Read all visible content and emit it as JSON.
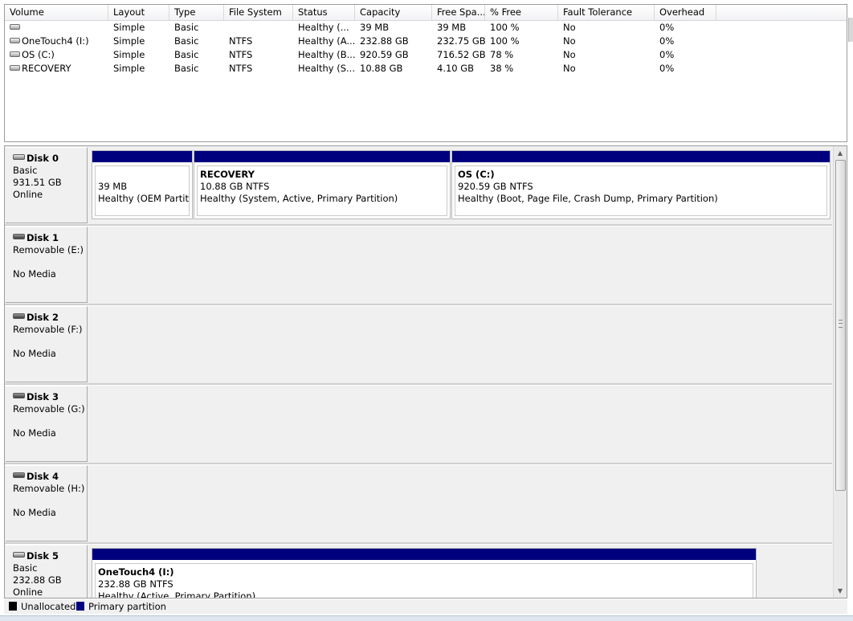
{
  "volume_list": {
    "columns": [
      "Volume",
      "Layout",
      "Type",
      "File System",
      "Status",
      "Capacity",
      "Free Spa...",
      "% Free",
      "Fault Tolerance",
      "Overhead"
    ],
    "rows": [
      [
        "",
        "Simple",
        "Basic",
        "",
        "Healthy (...",
        "39 MB",
        "39 MB",
        "100 %",
        "No",
        "0%"
      ],
      [
        "OneTouch4 (I:)",
        "Simple",
        "Basic",
        "NTFS",
        "Healthy (A...",
        "232.88 GB",
        "232.75 GB",
        "100 %",
        "No",
        "0%"
      ],
      [
        "OS (C:)",
        "Simple",
        "Basic",
        "NTFS",
        "Healthy (B...",
        "920.59 GB",
        "716.52 GB",
        "78 %",
        "No",
        "0%"
      ],
      [
        "RECOVERY",
        "Simple",
        "Basic",
        "NTFS",
        "Healthy (S...",
        "10.88 GB",
        "4.10 GB",
        "38 %",
        "No",
        "0%"
      ]
    ]
  },
  "disks": [
    {
      "title": "Disk 0",
      "line1": "Basic",
      "line2": "931.51 GB",
      "line3": "Online",
      "icon": "hard-disk-icon",
      "partitions": [
        {
          "name": "",
          "size": "39 MB",
          "status": "Healthy (OEM Partition)"
        },
        {
          "name": "RECOVERY",
          "size": "10.88 GB NTFS",
          "status": "Healthy (System, Active, Primary Partition)"
        },
        {
          "name": "OS  (C:)",
          "size": "920.59 GB NTFS",
          "status": "Healthy (Boot, Page File, Crash Dump, Primary Partition)"
        }
      ]
    },
    {
      "title": "Disk 1",
      "line1": "Removable (E:)",
      "line2": "",
      "line3": "No Media",
      "icon": "removable-disk-icon",
      "partitions": []
    },
    {
      "title": "Disk 2",
      "line1": "Removable (F:)",
      "line2": "",
      "line3": "No Media",
      "icon": "removable-disk-icon",
      "partitions": []
    },
    {
      "title": "Disk 3",
      "line1": "Removable (G:)",
      "line2": "",
      "line3": "No Media",
      "icon": "removable-disk-icon",
      "partitions": []
    },
    {
      "title": "Disk 4",
      "line1": "Removable (H:)",
      "line2": "",
      "line3": "No Media",
      "icon": "removable-disk-icon",
      "partitions": []
    },
    {
      "title": "Disk 5",
      "line1": "Basic",
      "line2": "232.88 GB",
      "line3": "Online",
      "icon": "hard-disk-icon",
      "partitions": [
        {
          "name": "OneTouch4  (I:)",
          "size": "232.88 GB NTFS",
          "status": "Healthy (Active, Primary Partition)"
        }
      ]
    }
  ],
  "legend": {
    "unallocated_label": "Unallocated",
    "unallocated_color": "#000000",
    "primary_label": "Primary partition",
    "primary_color": "#00007f"
  }
}
